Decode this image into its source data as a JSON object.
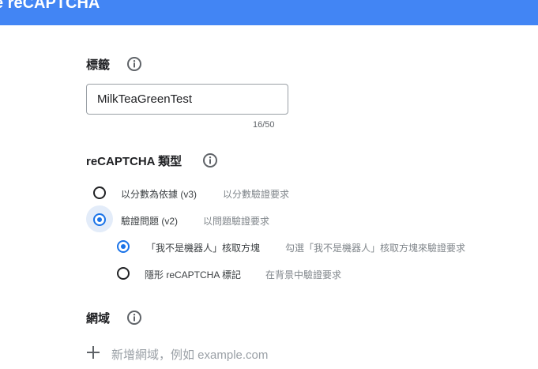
{
  "header": {
    "title": "e reCAPTCHA"
  },
  "label_section": {
    "heading": "標籤",
    "input_value": "MilkTeaGreenTest",
    "counter": "16/50"
  },
  "type_section": {
    "heading": "reCAPTCHA 類型",
    "options": [
      {
        "label": "以分數為依據 (v3)",
        "description": "以分數驗證要求",
        "selected": false
      },
      {
        "label": "驗證問題 (v2)",
        "description": "以問題驗證要求",
        "selected": true
      }
    ],
    "sub_options": [
      {
        "label": "「我不是機器人」核取方塊",
        "description": "勾選「我不是機器人」核取方塊來驗證要求",
        "selected": true
      },
      {
        "label": "隱形 reCAPTCHA 標記",
        "description": "在背景中驗證要求",
        "selected": false
      }
    ]
  },
  "domain_section": {
    "heading": "網域",
    "add_placeholder": "新增網域，例如 example.com"
  },
  "colors": {
    "header_bg": "#4285f4",
    "accent": "#1a73e8",
    "radio_halo": "#e3ecf9"
  },
  "icons": {
    "info": "info-circle-icon",
    "add": "plus-icon"
  }
}
